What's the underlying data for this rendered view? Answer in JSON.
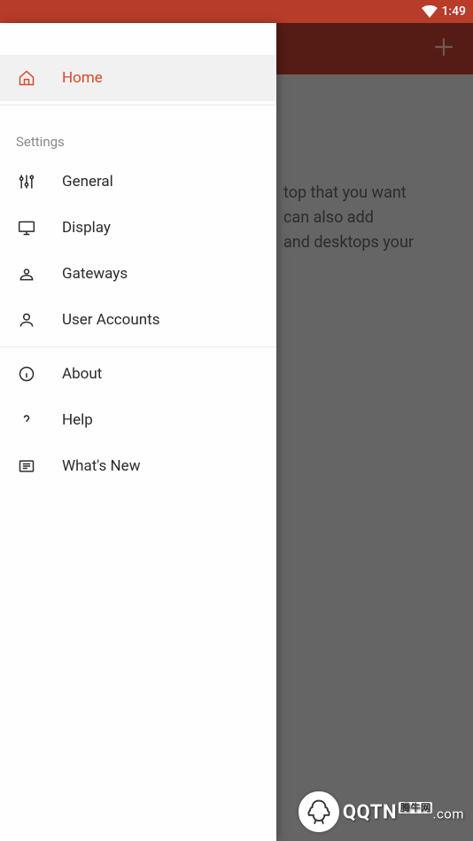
{
  "status": {
    "time": "1:49"
  },
  "background": {
    "line1": "top that you want",
    "line2": "can also add",
    "line3": "and desktops your"
  },
  "drawer": {
    "home": "Home",
    "section_settings": "Settings",
    "general": "General",
    "display": "Display",
    "gateways": "Gateways",
    "user_accounts": "User Accounts",
    "about": "About",
    "help": "Help",
    "whats_new": "What's New"
  },
  "watermark": {
    "brand": "QQTN",
    "sub": "腾牛网",
    "domain": ".com"
  }
}
